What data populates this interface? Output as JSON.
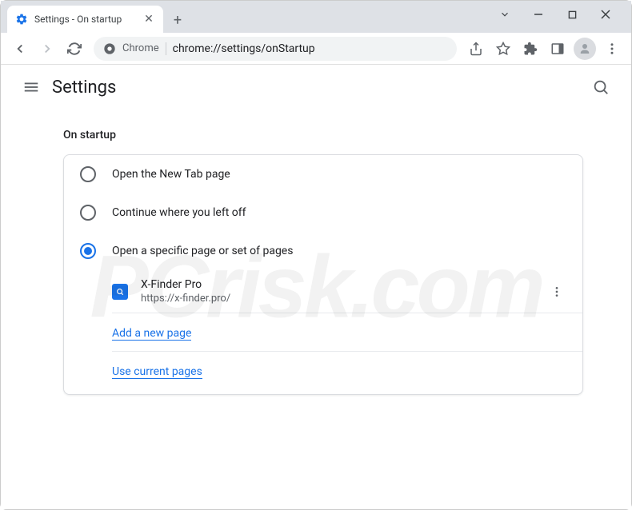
{
  "window": {
    "tab_title": "Settings - On startup"
  },
  "toolbar": {
    "omnibox_label": "Chrome",
    "omnibox_url": "chrome://settings/onStartup"
  },
  "header": {
    "title": "Settings"
  },
  "section": {
    "title": "On startup",
    "options": [
      {
        "label": "Open the New Tab page",
        "selected": false
      },
      {
        "label": "Continue where you left off",
        "selected": false
      },
      {
        "label": "Open a specific page or set of pages",
        "selected": true
      }
    ],
    "pages": [
      {
        "name": "X-Finder Pro",
        "url": "https://x-finder.pro/"
      }
    ],
    "add_page_label": "Add a new page",
    "use_current_label": "Use current pages"
  },
  "watermark": "PCrisk.com"
}
